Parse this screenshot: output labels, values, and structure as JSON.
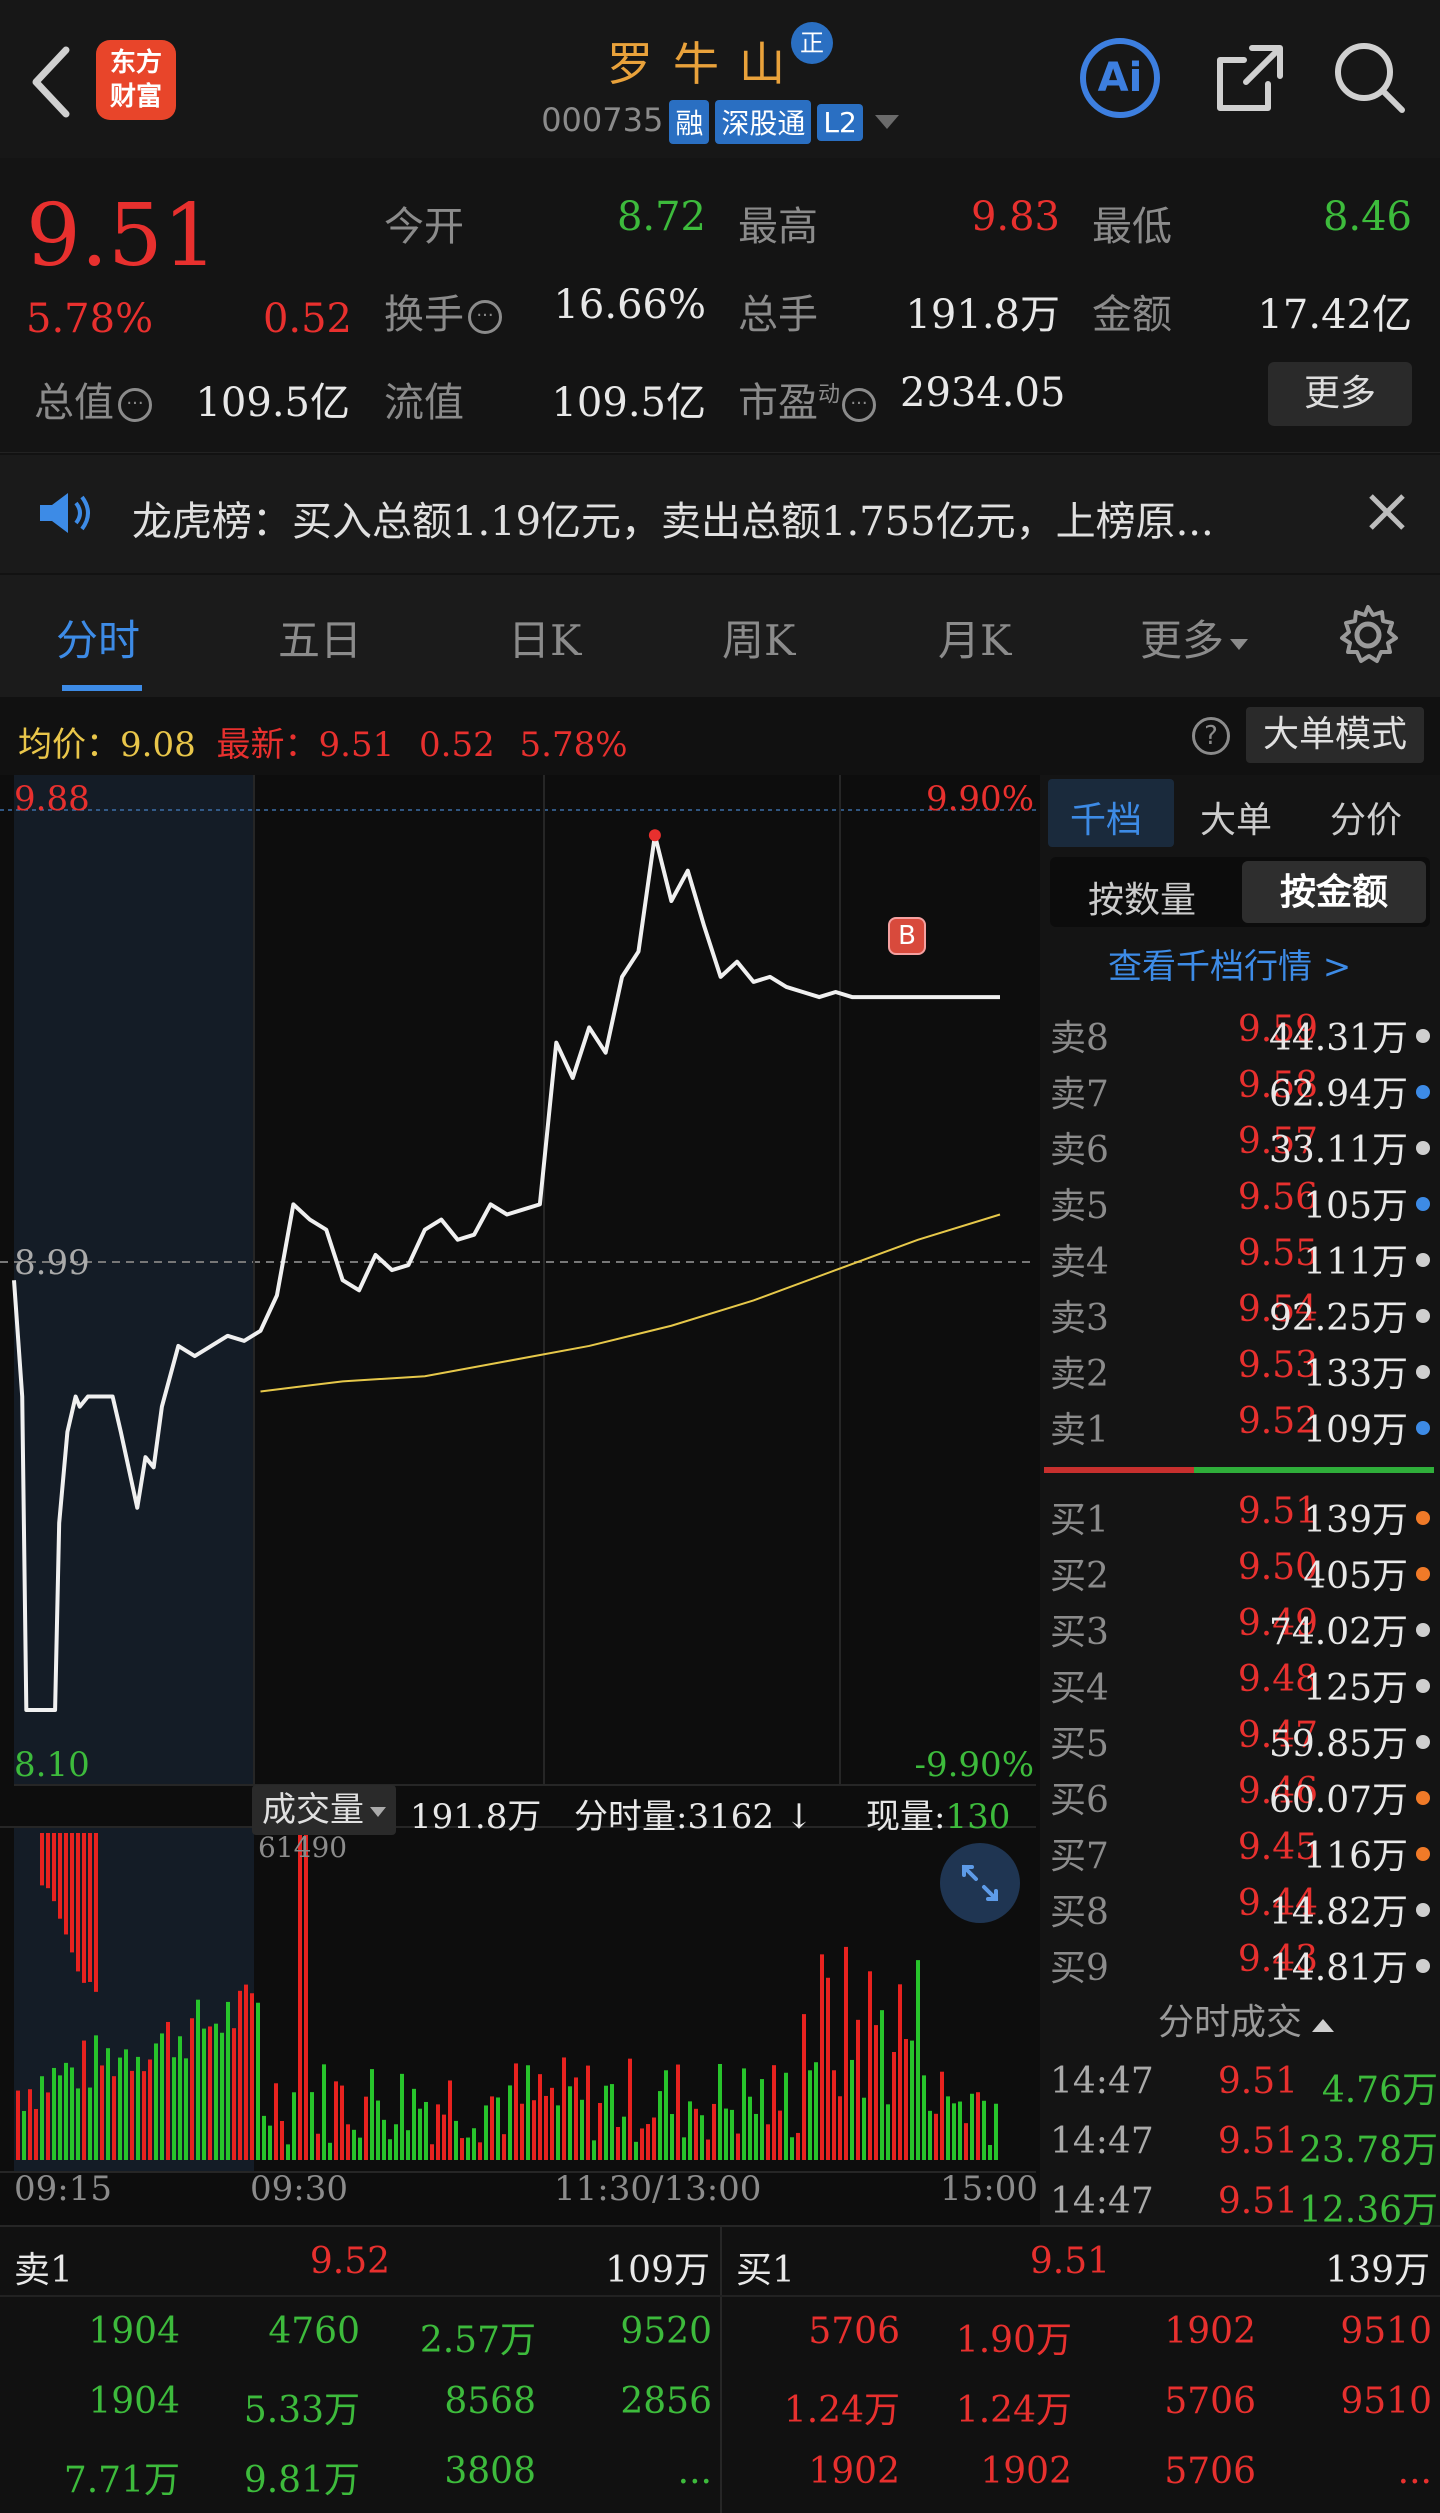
{
  "header": {
    "title": "罗牛山",
    "badge": "正",
    "code": "000735",
    "tags": [
      "融",
      "深股通",
      "L2"
    ],
    "logo_line1": "东方",
    "logo_line2": "财富",
    "ai_label": "Ai"
  },
  "quote": {
    "price": "9.51",
    "change_pct": "5.78%",
    "change": "0.52",
    "open_label": "今开",
    "open": "8.72",
    "high_label": "最高",
    "high": "9.83",
    "low_label": "最低",
    "low": "8.46",
    "turnover_label": "换手",
    "turnover": "16.66%",
    "volume_label": "总手",
    "volume": "191.8万",
    "amount_label": "金额",
    "amount": "17.42亿",
    "mcap_label": "总值",
    "mcap": "109.5亿",
    "float_label": "流值",
    "float": "109.5亿",
    "pe_label": "市盈",
    "pe_sup": "动",
    "pe": "2934.05",
    "more_label": "更多"
  },
  "notice": {
    "text": "龙虎榜：买入总额1.19亿元，卖出总额1.755亿元，上榜原..."
  },
  "tabs": [
    "分时",
    "五日",
    "日K",
    "周K",
    "月K",
    "更多"
  ],
  "chart_info": {
    "avg_label": "均价：",
    "avg": "9.08",
    "latest_label": "最新：",
    "latest": "9.51",
    "latest_chg": "0.52",
    "latest_pct": "5.78%",
    "mode_button": "大单模式",
    "price_top": "9.88",
    "price_mid": "8.99",
    "price_bottom": "8.10",
    "pct_top": "9.90%",
    "pct_bottom": "-9.90%",
    "vol_menu": "成交量",
    "vol_total": "191.8万",
    "vol_minute": "分时量:3162",
    "vol_now_label": "现量:",
    "vol_now": "130",
    "vol_max": "61490",
    "time_start": "09:15",
    "time_open": "09:30",
    "time_mid": "11:30/13:00",
    "time_end": "15:00",
    "marker": "B"
  },
  "book": {
    "tabs": [
      "千档",
      "大单",
      "分价"
    ],
    "subtabs": [
      "按数量",
      "按金额"
    ],
    "view_link": "查看千档行情 >",
    "asks": [
      {
        "label": "卖8",
        "price": "9.59",
        "vol": "44.31万",
        "dot": "#cfcfcf"
      },
      {
        "label": "卖7",
        "price": "9.58",
        "vol": "62.94万",
        "dot": "#3d8be6"
      },
      {
        "label": "卖6",
        "price": "9.57",
        "vol": "33.11万",
        "dot": "#cfcfcf"
      },
      {
        "label": "卖5",
        "price": "9.56",
        "vol": "105万",
        "dot": "#3d8be6"
      },
      {
        "label": "卖4",
        "price": "9.55",
        "vol": "111万",
        "dot": "#cfcfcf"
      },
      {
        "label": "卖3",
        "price": "9.54",
        "vol": "92.25万",
        "dot": "#cfcfcf"
      },
      {
        "label": "卖2",
        "price": "9.53",
        "vol": "133万",
        "dot": "#cfcfcf"
      },
      {
        "label": "卖1",
        "price": "9.52",
        "vol": "109万",
        "dot": "#3d8be6"
      }
    ],
    "bids": [
      {
        "label": "买1",
        "price": "9.51",
        "vol": "139万",
        "dot": "#f07a28"
      },
      {
        "label": "买2",
        "price": "9.50",
        "vol": "405万",
        "dot": "#f07a28"
      },
      {
        "label": "买3",
        "price": "9.49",
        "vol": "74.02万",
        "dot": "#cfcfcf"
      },
      {
        "label": "买4",
        "price": "9.48",
        "vol": "125万",
        "dot": "#cfcfcf"
      },
      {
        "label": "买5",
        "price": "9.47",
        "vol": "59.85万",
        "dot": "#cfcfcf"
      },
      {
        "label": "买6",
        "price": "9.46",
        "vol": "60.07万",
        "dot": "#f07a28"
      },
      {
        "label": "买7",
        "price": "9.45",
        "vol": "116万",
        "dot": "#f07a28"
      },
      {
        "label": "买8",
        "price": "9.44",
        "vol": "14.82万",
        "dot": "#cfcfcf"
      },
      {
        "label": "买9",
        "price": "9.43",
        "vol": "14.81万",
        "dot": "#cfcfcf"
      }
    ],
    "trades_label": "分时成交",
    "trades": [
      {
        "time": "14:47",
        "price": "9.51",
        "vol": "4.76万"
      },
      {
        "time": "14:47",
        "price": "9.51",
        "vol": "23.78万"
      },
      {
        "time": "14:47",
        "price": "9.51",
        "vol": "12.36万"
      }
    ]
  },
  "bottom": {
    "sell_label": "卖1",
    "sell_price": "9.52",
    "sell_vol": "109万",
    "buy_label": "买1",
    "buy_price": "9.51",
    "buy_vol": "139万",
    "sell_rows": [
      [
        "1904",
        "4760",
        "2.57万",
        "9520"
      ],
      [
        "1904",
        "5.33万",
        "8568",
        "2856"
      ],
      [
        "7.71万",
        "9.81万",
        "3808",
        "..."
      ]
    ],
    "buy_rows": [
      [
        "5706",
        "1.90万",
        "1902",
        "9510"
      ],
      [
        "1.24万",
        "1.24万",
        "5706",
        "9510"
      ],
      [
        "1902",
        "1902",
        "5706",
        "..."
      ]
    ]
  },
  "chart_data": {
    "type": "line",
    "ylim": [
      8.1,
      9.88
    ],
    "prev_close": 8.99,
    "price": {
      "x": [
        0,
        2,
        3,
        4,
        7,
        10,
        11,
        13,
        15,
        16,
        18,
        20,
        24,
        26,
        30,
        32,
        34,
        36,
        38,
        40,
        44,
        48,
        52,
        56,
        60,
        64,
        68,
        72,
        76,
        80,
        84,
        88,
        92,
        96,
        100,
        104,
        108,
        112,
        116,
        120,
        124,
        128,
        132,
        136,
        140,
        144,
        148,
        152,
        156,
        160,
        164,
        168,
        172,
        176,
        180,
        184,
        188,
        192,
        196,
        200,
        204,
        208,
        212,
        216,
        220,
        224,
        228,
        232,
        236,
        240
      ],
      "y": [
        8.95,
        8.72,
        8.1,
        8.1,
        8.1,
        8.1,
        8.47,
        8.65,
        8.72,
        8.7,
        8.72,
        8.72,
        8.72,
        8.65,
        8.5,
        8.6,
        8.58,
        8.7,
        8.76,
        8.82,
        8.8,
        8.82,
        8.84,
        8.83,
        8.85,
        8.92,
        9.1,
        9.07,
        9.05,
        8.95,
        8.93,
        9.0,
        8.97,
        8.98,
        9.05,
        9.07,
        9.03,
        9.04,
        9.1,
        9.08,
        9.09,
        9.1,
        9.42,
        9.35,
        9.45,
        9.4,
        9.55,
        9.6,
        9.83,
        9.7,
        9.76,
        9.65,
        9.55,
        9.58,
        9.54,
        9.55,
        9.53,
        9.52,
        9.51,
        9.52,
        9.51,
        9.51,
        9.51,
        9.51,
        9.51,
        9.51,
        9.51,
        9.51,
        9.51,
        9.51
      ]
    },
    "avg": {
      "x": [
        60,
        70,
        80,
        100,
        120,
        140,
        160,
        180,
        200,
        220,
        240
      ],
      "y": [
        8.73,
        8.74,
        8.75,
        8.76,
        8.79,
        8.82,
        8.86,
        8.91,
        8.97,
        9.03,
        9.08
      ]
    }
  }
}
